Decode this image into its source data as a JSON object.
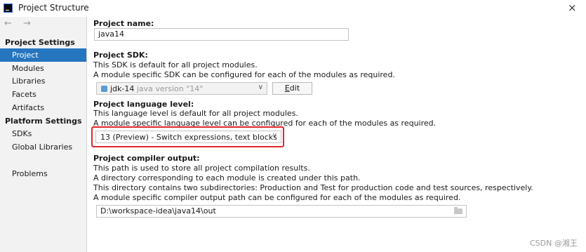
{
  "window": {
    "title": "Project Structure",
    "close_symbol": "×"
  },
  "sidebar": {
    "nav": "←  →",
    "project_settings_header": "Project Settings",
    "project_items": [
      "Project",
      "Modules",
      "Libraries",
      "Facets",
      "Artifacts"
    ],
    "platform_settings_header": "Platform Settings",
    "platform_items": [
      "SDKs",
      "Global Libraries"
    ],
    "problems": "Problems",
    "selected": "Project"
  },
  "main": {
    "name": {
      "label": "Project name:",
      "value": "java14"
    },
    "sdk": {
      "label": "Project SDK:",
      "desc1": "This SDK is default for all project modules.",
      "desc2": "A module specific SDK can be configured for each of the modules as required.",
      "selected_name": "jdk-14",
      "selected_version": "java version \"14\"",
      "edit_mnemonic": "E",
      "edit_rest": "dit"
    },
    "language": {
      "label": "Project language level:",
      "desc1": "This language level is default for all project modules.",
      "desc2": "A module specific language level can be configured for each of the modules as required.",
      "value": "13 (Preview) - Switch expressions, text blocks",
      "highlight_color": "#e0262a"
    },
    "output": {
      "label": "Project compiler output:",
      "desc1": "This path is used to store all project compilation results.",
      "desc2": "A directory corresponding to each module is created under this path.",
      "desc3": "This directory contains two subdirectories: Production and Test for production code and test sources, respectively.",
      "desc4": "A module specific compiler output path can be configured for each of the modules as required.",
      "path": "D:\\workspace-idea\\java14\\out"
    }
  },
  "watermark": "CSDN @湘王",
  "colors": {
    "selection": "#2675bf",
    "sidebar_bg": "#f2f2f2"
  }
}
